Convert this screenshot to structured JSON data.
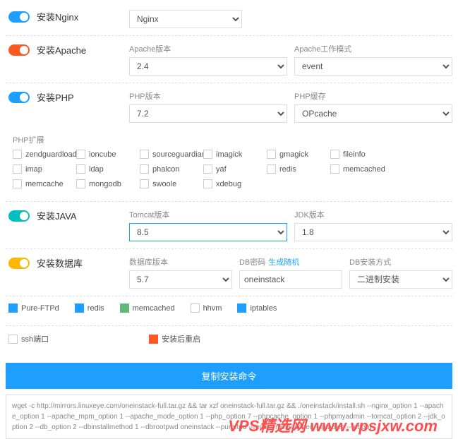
{
  "nginx": {
    "title": "安装Nginx",
    "select_label": "",
    "value": "Nginx"
  },
  "apache": {
    "title": "安装Apache",
    "ver_label": "Apache版本",
    "ver_value": "2.4",
    "mode_label": "Apache工作模式",
    "mode_value": "event"
  },
  "php": {
    "title": "安装PHP",
    "ver_label": "PHP版本",
    "ver_value": "7.2",
    "cache_label": "PHP缓存",
    "cache_value": "OPcache"
  },
  "php_ext": {
    "label": "PHP扩展",
    "items": [
      "zendguardloader",
      "ioncube",
      "sourceguardian",
      "imagick",
      "gmagick",
      "fileinfo",
      "imap",
      "ldap",
      "phalcon",
      "yaf",
      "redis",
      "memcached",
      "memcache",
      "mongodb",
      "swoole",
      "xdebug"
    ]
  },
  "java": {
    "title": "安装JAVA",
    "tomcat_label": "Tomcat版本",
    "tomcat_value": "8.5",
    "jdk_label": "JDK版本",
    "jdk_value": "1.8"
  },
  "db": {
    "title": "安装数据库",
    "ver_label": "数据库版本",
    "ver_value": "5.7",
    "pwd_label": "DB密码",
    "pwd_gen": "生成随机",
    "pwd_value": "oneinstack",
    "method_label": "DB安装方式",
    "method_value": "二进制安装"
  },
  "opts": {
    "items": [
      {
        "label": "Pure-FTPd",
        "state": "on"
      },
      {
        "label": "redis",
        "state": "on"
      },
      {
        "label": "memcached",
        "state": "green"
      },
      {
        "label": "hhvm",
        "state": "off"
      },
      {
        "label": "iptables",
        "state": "on"
      }
    ],
    "row2": [
      {
        "label": "ssh端口",
        "state": "off"
      },
      {
        "label": "安装后重启",
        "state": "red"
      }
    ]
  },
  "copy_btn": "复制安装命令",
  "cmd": "wget -c http://mirrors.linuxeye.com/oneinstack-full.tar.gz && tar xzf oneinstack-full.tar.gz && ./oneinstack/install.sh --nginx_option 1 --apache_option 1 --apache_mpm_option 1 --apache_mode_option 1 --php_option 7 --phpcache_option 1 --phpmyadmin --tomcat_option 2 --jdk_option 2 --db_option 2 --dbinstallmethod 1 --dbrootpwd oneinstack --pureftpd --redis --memcached --iptables --reboot",
  "watermark_en": "www.vpsjxw.com",
  "watermark_cn": "VPS精选网"
}
